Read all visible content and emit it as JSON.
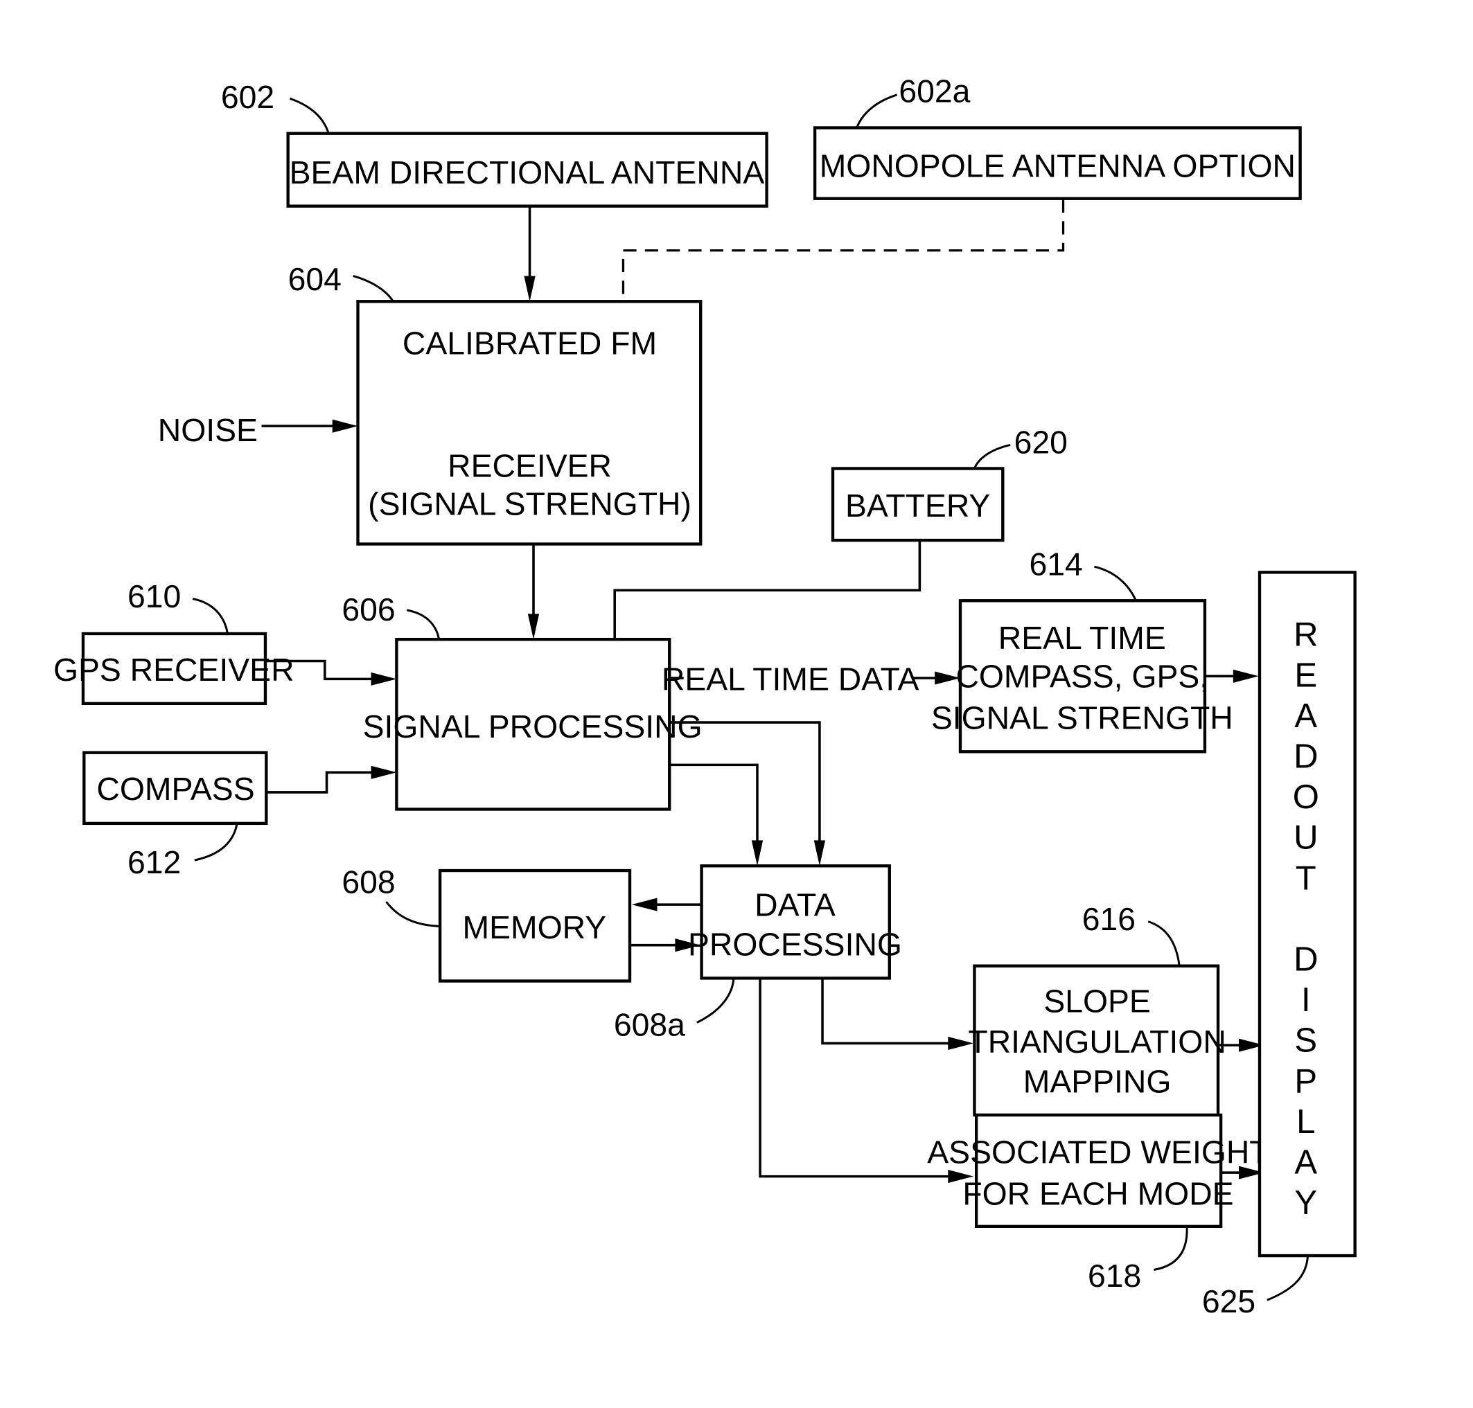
{
  "figure": {
    "blocks": {
      "beam_antenna": {
        "ref": "602",
        "label": "BEAM  DIRECTIONAL  ANTENNA"
      },
      "monopole_antenna": {
        "ref": "602a",
        "label": "MONOPOLE  ANTENNA  OPTION"
      },
      "fm_receiver": {
        "ref": "604",
        "line1": "CALIBRATED  FM",
        "line2": "RECEIVER",
        "line3": "(SIGNAL  STRENGTH)"
      },
      "battery": {
        "ref": "620",
        "label": "BATTERY"
      },
      "gps_receiver": {
        "ref": "610",
        "label": "GPS  RECEIVER"
      },
      "compass": {
        "ref": "612",
        "label": "COMPASS"
      },
      "signal_processing": {
        "ref": "606",
        "label": "SIGNAL  PROCESSING"
      },
      "real_time_display": {
        "ref": "614",
        "line1": "REAL  TIME",
        "line2": "COMPASS,  GPS,",
        "line3": "SIGNAL  STRENGTH"
      },
      "memory": {
        "ref": "608",
        "label": "MEMORY"
      },
      "data_processing": {
        "ref": "608a",
        "line1": "DATA",
        "line2": "PROCESSING"
      },
      "slope_triangulation": {
        "ref": "616",
        "line1": "SLOPE",
        "line2": "TRIANGULATION",
        "line3": "MAPPING"
      },
      "associated_weight": {
        "ref": "618",
        "line1": "ASSOCIATED  WEIGHT",
        "line2": "FOR  EACH  MODE"
      },
      "readout_display": {
        "ref": "625",
        "letters": [
          "R",
          "E",
          "A",
          "D",
          "O",
          "U",
          "T",
          "D",
          "I",
          "S",
          "P",
          "L",
          "A",
          "Y"
        ]
      }
    },
    "signals": {
      "noise": "NOISE",
      "real_time_data": "REAL  TIME  DATA"
    }
  }
}
